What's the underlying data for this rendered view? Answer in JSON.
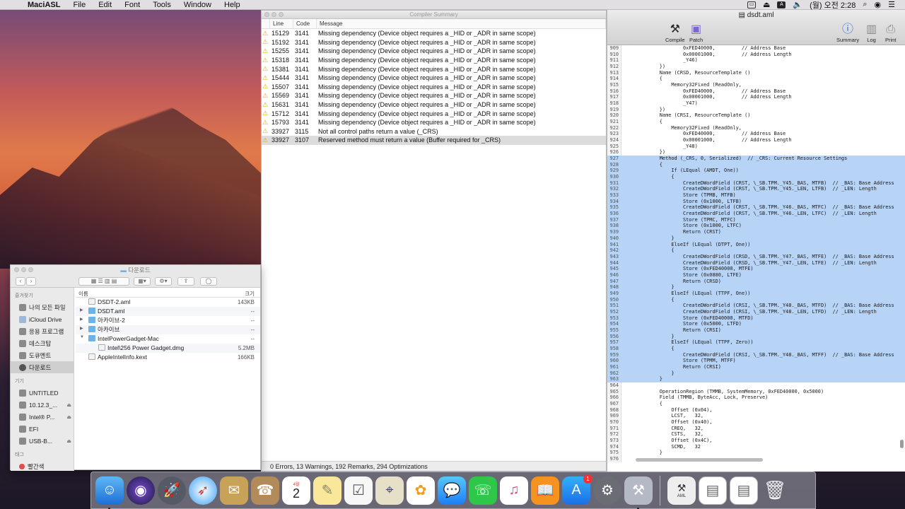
{
  "menubar": {
    "app": "MaciASL",
    "items": [
      "File",
      "Edit",
      "Font",
      "Tools",
      "Window",
      "Help"
    ],
    "clock": "(월) 오전 2:28",
    "input_badge": "A"
  },
  "summary": {
    "title": "Compiler Summary",
    "col_line": "Line",
    "col_code": "Code",
    "col_message": "Message",
    "rows": [
      {
        "line": "15129",
        "code": "3141",
        "msg": "Missing dependency (Device object requires a _HID or _ADR in same scope)"
      },
      {
        "line": "15192",
        "code": "3141",
        "msg": "Missing dependency (Device object requires a _HID or _ADR in same scope)"
      },
      {
        "line": "15255",
        "code": "3141",
        "msg": "Missing dependency (Device object requires a _HID or _ADR in same scope)"
      },
      {
        "line": "15318",
        "code": "3141",
        "msg": "Missing dependency (Device object requires a _HID or _ADR in same scope)"
      },
      {
        "line": "15381",
        "code": "3141",
        "msg": "Missing dependency (Device object requires a _HID or _ADR in same scope)"
      },
      {
        "line": "15444",
        "code": "3141",
        "msg": "Missing dependency (Device object requires a _HID or _ADR in same scope)"
      },
      {
        "line": "15507",
        "code": "3141",
        "msg": "Missing dependency (Device object requires a _HID or _ADR in same scope)"
      },
      {
        "line": "15569",
        "code": "3141",
        "msg": "Missing dependency (Device object requires a _HID or _ADR in same scope)"
      },
      {
        "line": "15631",
        "code": "3141",
        "msg": "Missing dependency (Device object requires a _HID or _ADR in same scope)"
      },
      {
        "line": "15712",
        "code": "3141",
        "msg": "Missing dependency (Device object requires a _HID or _ADR in same scope)"
      },
      {
        "line": "15793",
        "code": "3141",
        "msg": "Missing dependency (Device object requires a _HID or _ADR in same scope)"
      },
      {
        "line": "33927",
        "code": "3115",
        "msg": "Not all control paths return a value (_CRS)"
      },
      {
        "line": "33927",
        "code": "3107",
        "msg": "Reserved method must return a value (Buffer required for _CRS)"
      }
    ],
    "status": "0 Errors, 13 Warnings, 192 Remarks, 294 Optimizations"
  },
  "dsdt": {
    "title": "dsdt.aml",
    "toolbar": {
      "compile": "Compile",
      "patch": "Patch",
      "summary": "Summary",
      "log": "Log",
      "print": "Print"
    },
    "lines": [
      {
        "n": "909",
        "t": "                    0xFED40000,         // Address Base",
        "sel": false
      },
      {
        "n": "910",
        "t": "                    0x00001000,         // Address Length",
        "sel": false
      },
      {
        "n": "911",
        "t": "                    _Y46)",
        "sel": false
      },
      {
        "n": "912",
        "t": "            })",
        "sel": false
      },
      {
        "n": "913",
        "t": "            Name (CRSD, ResourceTemplate ()",
        "sel": false
      },
      {
        "n": "914",
        "t": "            {",
        "sel": false
      },
      {
        "n": "915",
        "t": "                Memory32Fixed (ReadOnly,",
        "sel": false
      },
      {
        "n": "916",
        "t": "                    0xFED40000,         // Address Base",
        "sel": false
      },
      {
        "n": "917",
        "t": "                    0x00001000,         // Address Length",
        "sel": false
      },
      {
        "n": "918",
        "t": "                    _Y47)",
        "sel": false
      },
      {
        "n": "919",
        "t": "            })",
        "sel": false
      },
      {
        "n": "920",
        "t": "            Name (CRSI, ResourceTemplate ()",
        "sel": false
      },
      {
        "n": "921",
        "t": "            {",
        "sel": false
      },
      {
        "n": "922",
        "t": "                Memory32Fixed (ReadOnly,",
        "sel": false
      },
      {
        "n": "923",
        "t": "                    0xFED40000,         // Address Base",
        "sel": false
      },
      {
        "n": "924",
        "t": "                    0x00001000,         // Address Length",
        "sel": false
      },
      {
        "n": "925",
        "t": "                    _Y48)",
        "sel": false
      },
      {
        "n": "926",
        "t": "            })",
        "sel": false
      },
      {
        "n": "927",
        "t": "            Method (_CRS, 0, Serialized)  // _CRS: Current Resource Settings",
        "sel": true
      },
      {
        "n": "928",
        "t": "            {",
        "sel": true
      },
      {
        "n": "929",
        "t": "                If (LEqual (AMDT, One))",
        "sel": true
      },
      {
        "n": "930",
        "t": "                {",
        "sel": true
      },
      {
        "n": "931",
        "t": "                    CreateDWordField (CRST, \\_SB.TPM._Y45._BAS, MTFB)  // _BAS: Base Address",
        "sel": true
      },
      {
        "n": "932",
        "t": "                    CreateDWordField (CRST, \\_SB.TPM._Y45._LEN, LTFB)  // _LEN: Length",
        "sel": true
      },
      {
        "n": "933",
        "t": "                    Store (TPMB, MTFB)",
        "sel": true
      },
      {
        "n": "934",
        "t": "                    Store (0x1000, LTFB)",
        "sel": true
      },
      {
        "n": "935",
        "t": "                    CreateDWordField (CRST, \\_SB.TPM._Y46._BAS, MTFC)  // _BAS: Base Address",
        "sel": true
      },
      {
        "n": "936",
        "t": "                    CreateDWordField (CRST, \\_SB.TPM._Y46._LEN, LTFC)  // _LEN: Length",
        "sel": true
      },
      {
        "n": "937",
        "t": "                    Store (TPMC, MTFC)",
        "sel": true
      },
      {
        "n": "938",
        "t": "                    Store (0x1000, LTFC)",
        "sel": true
      },
      {
        "n": "939",
        "t": "                    Return (CRST)",
        "sel": true
      },
      {
        "n": "940",
        "t": "                }",
        "sel": true
      },
      {
        "n": "941",
        "t": "                ElseIf (LEqual (DTPT, One))",
        "sel": true
      },
      {
        "n": "942",
        "t": "                {",
        "sel": true
      },
      {
        "n": "943",
        "t": "                    CreateDWordField (CRSD, \\_SB.TPM._Y47._BAS, MTFE)  // _BAS: Base Address",
        "sel": true
      },
      {
        "n": "944",
        "t": "                    CreateDWordField (CRSD, \\_SB.TPM._Y47._LEN, LTFE)  // _LEN: Length",
        "sel": true
      },
      {
        "n": "945",
        "t": "                    Store (0xFED40000, MTFE)",
        "sel": true
      },
      {
        "n": "946",
        "t": "                    Store (0x0880, LTFE)",
        "sel": true
      },
      {
        "n": "947",
        "t": "                    Return (CRSD)",
        "sel": true
      },
      {
        "n": "948",
        "t": "                }",
        "sel": true
      },
      {
        "n": "949",
        "t": "                ElseIf (LEqual (TTPF, One))",
        "sel": true
      },
      {
        "n": "950",
        "t": "                {",
        "sel": true
      },
      {
        "n": "951",
        "t": "                    CreateDWordField (CRSI, \\_SB.TPM._Y48._BAS, MTFD)  // _BAS: Base Address",
        "sel": true
      },
      {
        "n": "952",
        "t": "                    CreateDWordField (CRSI, \\_SB.TPM._Y48._LEN, LTFD)  // _LEN: Length",
        "sel": true
      },
      {
        "n": "953",
        "t": "                    Store (0xFED40000, MTFD)",
        "sel": true
      },
      {
        "n": "954",
        "t": "                    Store (0x5000, LTFD)",
        "sel": true
      },
      {
        "n": "955",
        "t": "                    Return (CRSI)",
        "sel": true
      },
      {
        "n": "956",
        "t": "                }",
        "sel": true
      },
      {
        "n": "957",
        "t": "                ElseIf (LEqual (TTPF, Zero))",
        "sel": true
      },
      {
        "n": "958",
        "t": "                {",
        "sel": true
      },
      {
        "n": "959",
        "t": "                    CreateDWordField (CRSI, \\_SB.TPM._Y48._BAS, MTFF)  // _BAS: Base Address",
        "sel": true
      },
      {
        "n": "960",
        "t": "                    Store (TPMM, MTFF)",
        "sel": true
      },
      {
        "n": "961",
        "t": "                    Return (CRSI)",
        "sel": true
      },
      {
        "n": "962",
        "t": "                }",
        "sel": true
      },
      {
        "n": "963",
        "t": "            }",
        "sel": true
      },
      {
        "n": "964",
        "t": "",
        "sel": false
      },
      {
        "n": "965",
        "t": "            OperationRegion (TMMB, SystemMemory, 0xFED40000, 0x5000)",
        "sel": false
      },
      {
        "n": "966",
        "t": "            Field (TMMB, ByteAcc, Lock, Preserve)",
        "sel": false
      },
      {
        "n": "967",
        "t": "            {",
        "sel": false
      },
      {
        "n": "968",
        "t": "                Offset (0x04),",
        "sel": false
      },
      {
        "n": "969",
        "t": "                LCST,   32,",
        "sel": false
      },
      {
        "n": "970",
        "t": "                Offset (0x40),",
        "sel": false
      },
      {
        "n": "971",
        "t": "                CREQ,   32,",
        "sel": false
      },
      {
        "n": "972",
        "t": "                CSTS,   32,",
        "sel": false
      },
      {
        "n": "973",
        "t": "                Offset (0x4C),",
        "sel": false
      },
      {
        "n": "974",
        "t": "                SCMD,   32",
        "sel": false
      },
      {
        "n": "975",
        "t": "            }",
        "sel": false
      },
      {
        "n": "976",
        "t": "",
        "sel": false
      }
    ]
  },
  "finder": {
    "title": "다운로드",
    "sidebar": {
      "favorites_head": "즐겨찾기",
      "favorites": [
        "나의 모든 파일",
        "iCloud Drive",
        "응용 프로그램",
        "데스크탑",
        "도큐멘트",
        "다운로드"
      ],
      "devices_head": "기기",
      "devices": [
        "UNTITLED",
        "10.12.3_...",
        "Intel® P...",
        "EFI",
        "USB-B..."
      ],
      "tags_head": "태그",
      "tags": [
        "빨간색"
      ]
    },
    "col_name": "이름",
    "col_size": "크기",
    "files": [
      {
        "name": "DSDT-2.aml",
        "size": "143KB",
        "type": "file",
        "indent": 0,
        "tri": ""
      },
      {
        "name": "DSDT.aml",
        "size": "--",
        "type": "folder",
        "indent": 0,
        "tri": "▶"
      },
      {
        "name": "아카이브-2",
        "size": "--",
        "type": "folder",
        "indent": 0,
        "tri": "▶"
      },
      {
        "name": "아카이브",
        "size": "--",
        "type": "folder",
        "indent": 0,
        "tri": "▶"
      },
      {
        "name": "IntelPowerGadget-Mac",
        "size": "--",
        "type": "folder",
        "indent": 0,
        "tri": "▼"
      },
      {
        "name": "Intel\\256 Power Gadget.dmg",
        "size": "5.2MB",
        "type": "file",
        "indent": 1,
        "tri": ""
      },
      {
        "name": "AppleIntelInfo.kext",
        "size": "166KB",
        "type": "file",
        "indent": 0,
        "tri": ""
      }
    ]
  },
  "dock": {
    "calendar_month": "4월",
    "calendar_day": "2",
    "appstore_badge": "1",
    "aml_label": "AML"
  }
}
